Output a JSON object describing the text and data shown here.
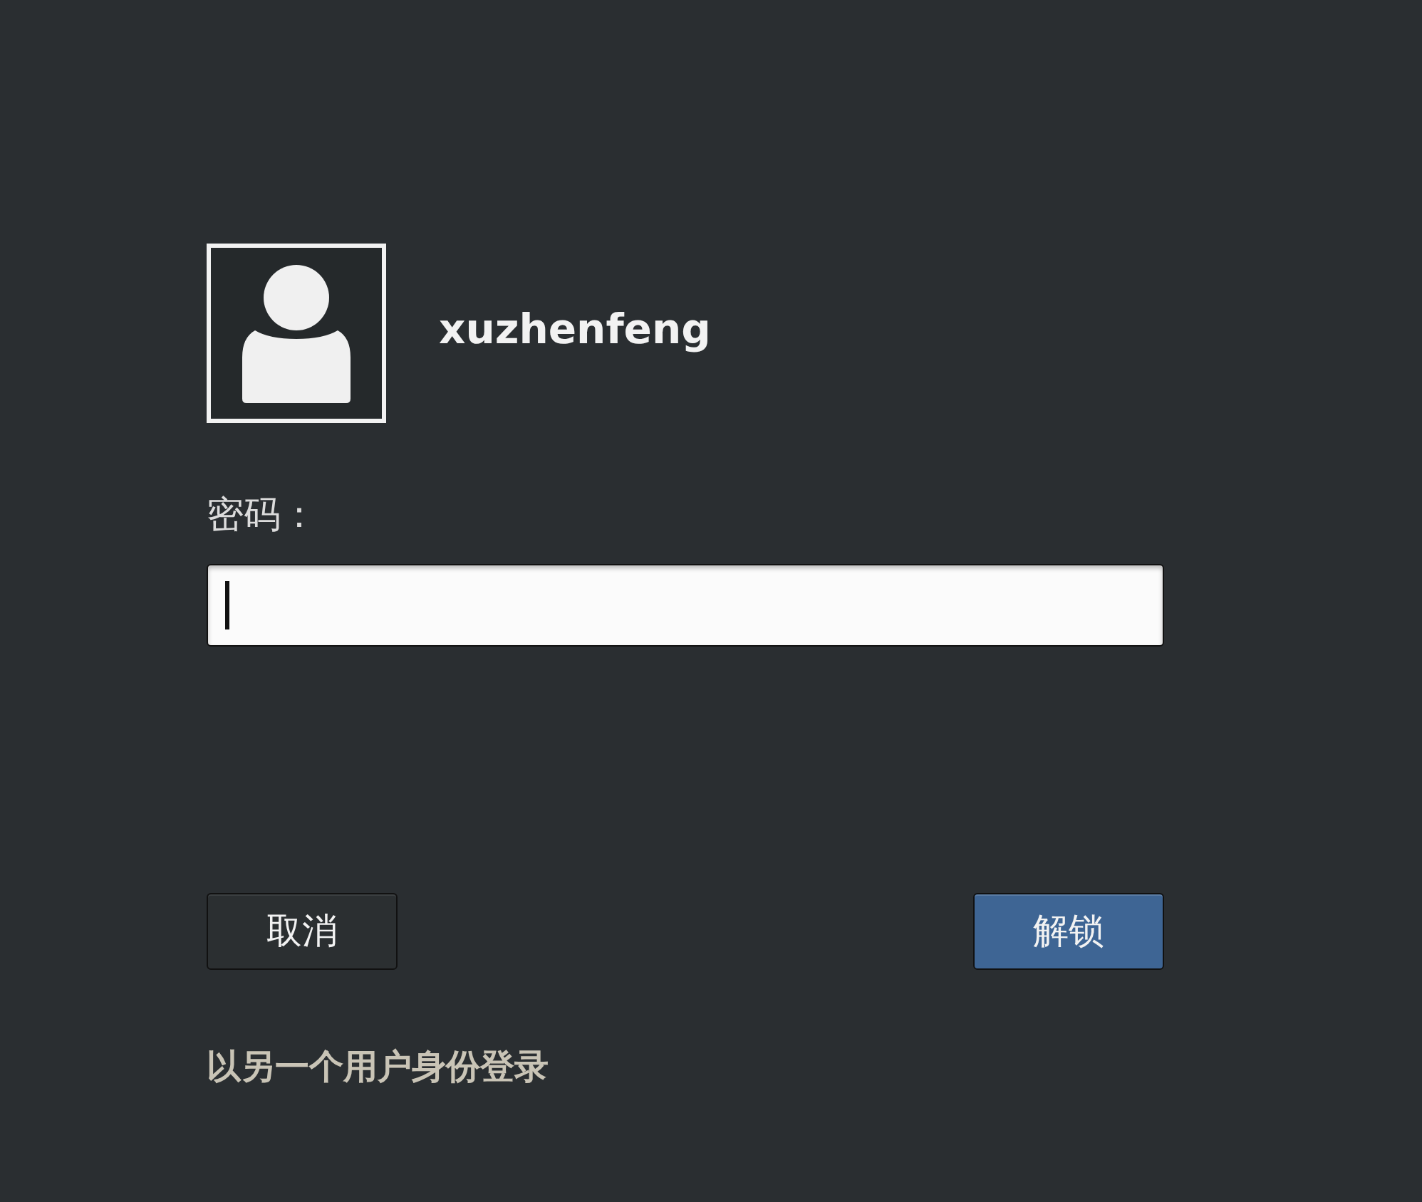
{
  "user": {
    "name": "xuzhenfeng"
  },
  "password": {
    "label": "密码：",
    "focused": true
  },
  "buttons": [
    {
      "label": "取消",
      "kind": "secondary"
    },
    {
      "label": "解锁",
      "kind": "primary"
    }
  ],
  "switch_user_link": "以另一个用户身份登录"
}
